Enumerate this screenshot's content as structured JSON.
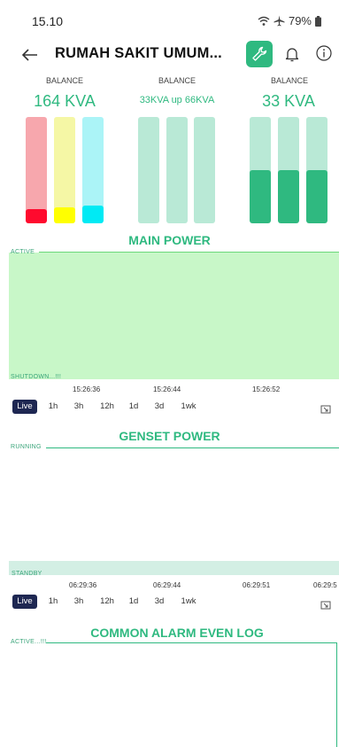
{
  "status": {
    "time": "15.10",
    "battery": "79%"
  },
  "header": {
    "title": "RUMAH SAKIT UMUM..."
  },
  "balance": [
    {
      "label": "BALANCE",
      "value": "164 KVA",
      "bars": [
        {
          "track": "#f7a7ad",
          "fill": "#ff0a2e",
          "level": 0.13
        },
        {
          "track": "#f5f7a5",
          "fill": "#ffff00",
          "level": 0.15
        },
        {
          "track": "#abf4f7",
          "fill": "#00eaf4",
          "level": 0.17
        }
      ]
    },
    {
      "label": "BALANCE",
      "value": "33KVA up 66KVA",
      "bars": [
        {
          "track": "#b9e9d6",
          "fill": "#b9e9d6",
          "level": 0
        },
        {
          "track": "#b9e9d6",
          "fill": "#b9e9d6",
          "level": 0
        },
        {
          "track": "#b9e9d6",
          "fill": "#b9e9d6",
          "level": 0
        }
      ]
    },
    {
      "label": "BALANCE",
      "value": "33 KVA",
      "bars": [
        {
          "track": "#b9e9d6",
          "fill": "#2fb980",
          "level": 0.5
        },
        {
          "track": "#b9e9d6",
          "fill": "#2fb980",
          "level": 0.5
        },
        {
          "track": "#b9e9d6",
          "fill": "#2fb980",
          "level": 0.5
        }
      ]
    }
  ],
  "main_power": {
    "title": "MAIN POWER",
    "top_label": "ACTIVE",
    "bottom_label": "SHUTDOWN...!!!",
    "times": [
      "15:26:36",
      "15:26:44",
      "15:26:52"
    ],
    "fill_color": "#c8f7c8"
  },
  "genset_power": {
    "title": "GENSET POWER",
    "top_label": "RUNNING",
    "bottom_label": "STANDBY",
    "times": [
      "06:29:36",
      "06:29:44",
      "06:29:51",
      "06:29:5"
    ]
  },
  "ranges": [
    "Live",
    "1h",
    "3h",
    "12h",
    "1d",
    "3d",
    "1wk"
  ],
  "alarm_log": {
    "title": "COMMON ALARM EVEN LOG",
    "top_label": "ACTIVE...!!!"
  },
  "colors": {
    "accent": "#2fb980",
    "live_bg": "#1e2752"
  }
}
